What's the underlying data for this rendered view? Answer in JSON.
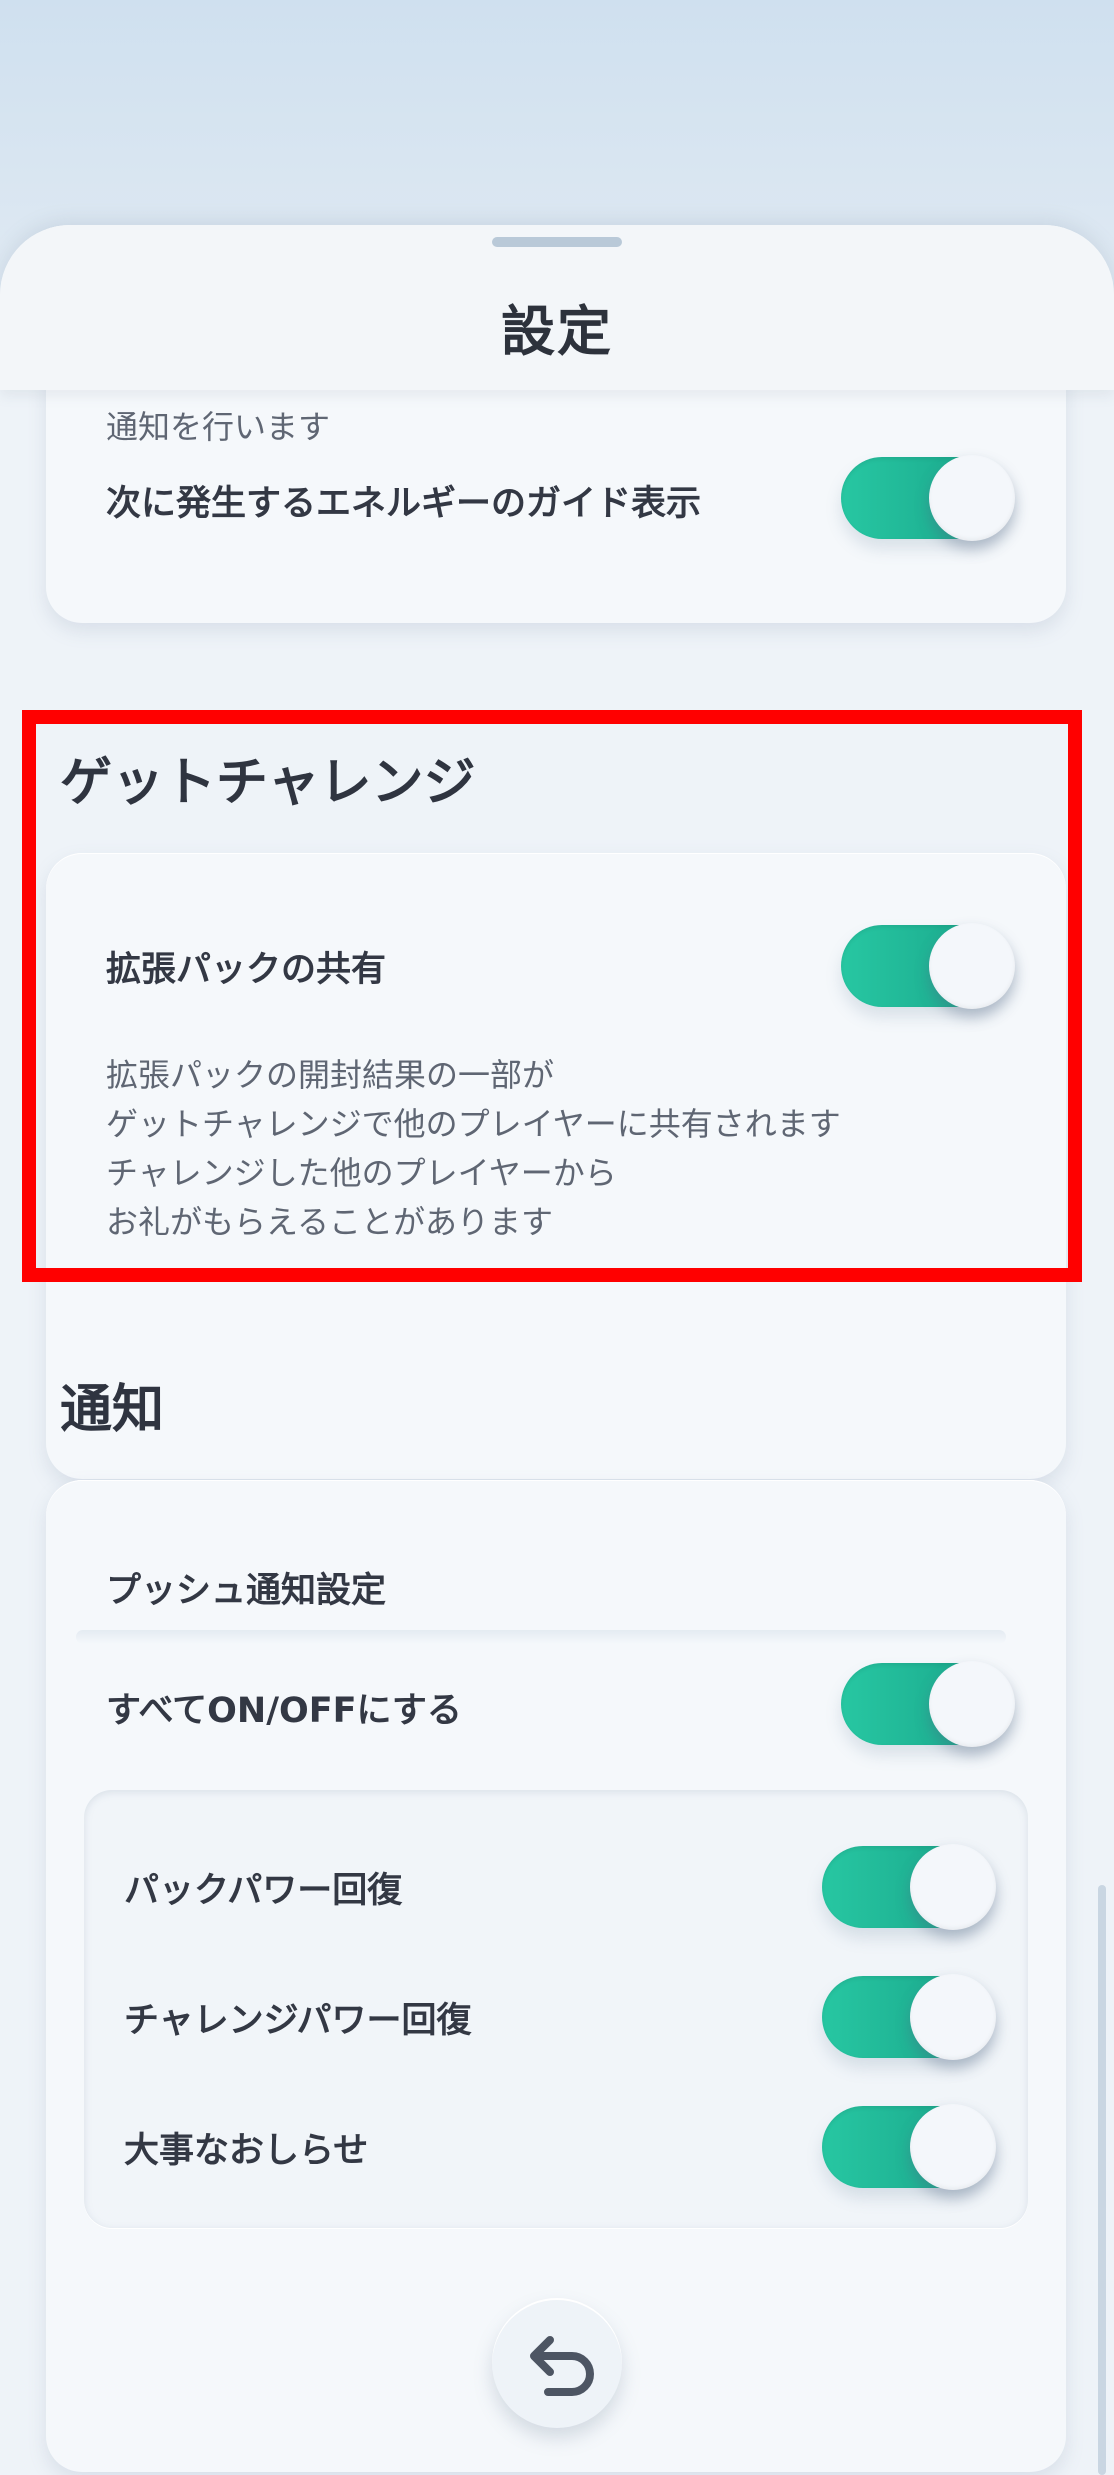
{
  "header": {
    "title": "設定"
  },
  "top_card": {
    "cut_text": "通知を行います",
    "row_label": "次に発生するエネルギーのガイド表示",
    "toggle_on": true
  },
  "get_challenge": {
    "title": "ゲットチャレンジ",
    "row_label": "拡張パックの共有",
    "toggle_on": true,
    "description": [
      "拡張パックの開封結果の一部が",
      "ゲットチャレンジで他のプレイヤーに共有されます",
      "チャレンジした他のプレイヤーから",
      "お礼がもらえることがあります"
    ]
  },
  "notification": {
    "title": "通知",
    "push_label": "プッシュ通知設定",
    "all_label": "すべてON/OFFにする",
    "all_on": true,
    "items": [
      {
        "label": "パックパワー回復",
        "on": true
      },
      {
        "label": "チャレンジパワー回復",
        "on": true
      },
      {
        "label": "大事なおしらせ",
        "on": true
      }
    ]
  },
  "icons": {
    "back": "return-arrow-icon"
  },
  "colors": {
    "toggle_on": "#1fb394",
    "highlight": "#ff0000"
  }
}
